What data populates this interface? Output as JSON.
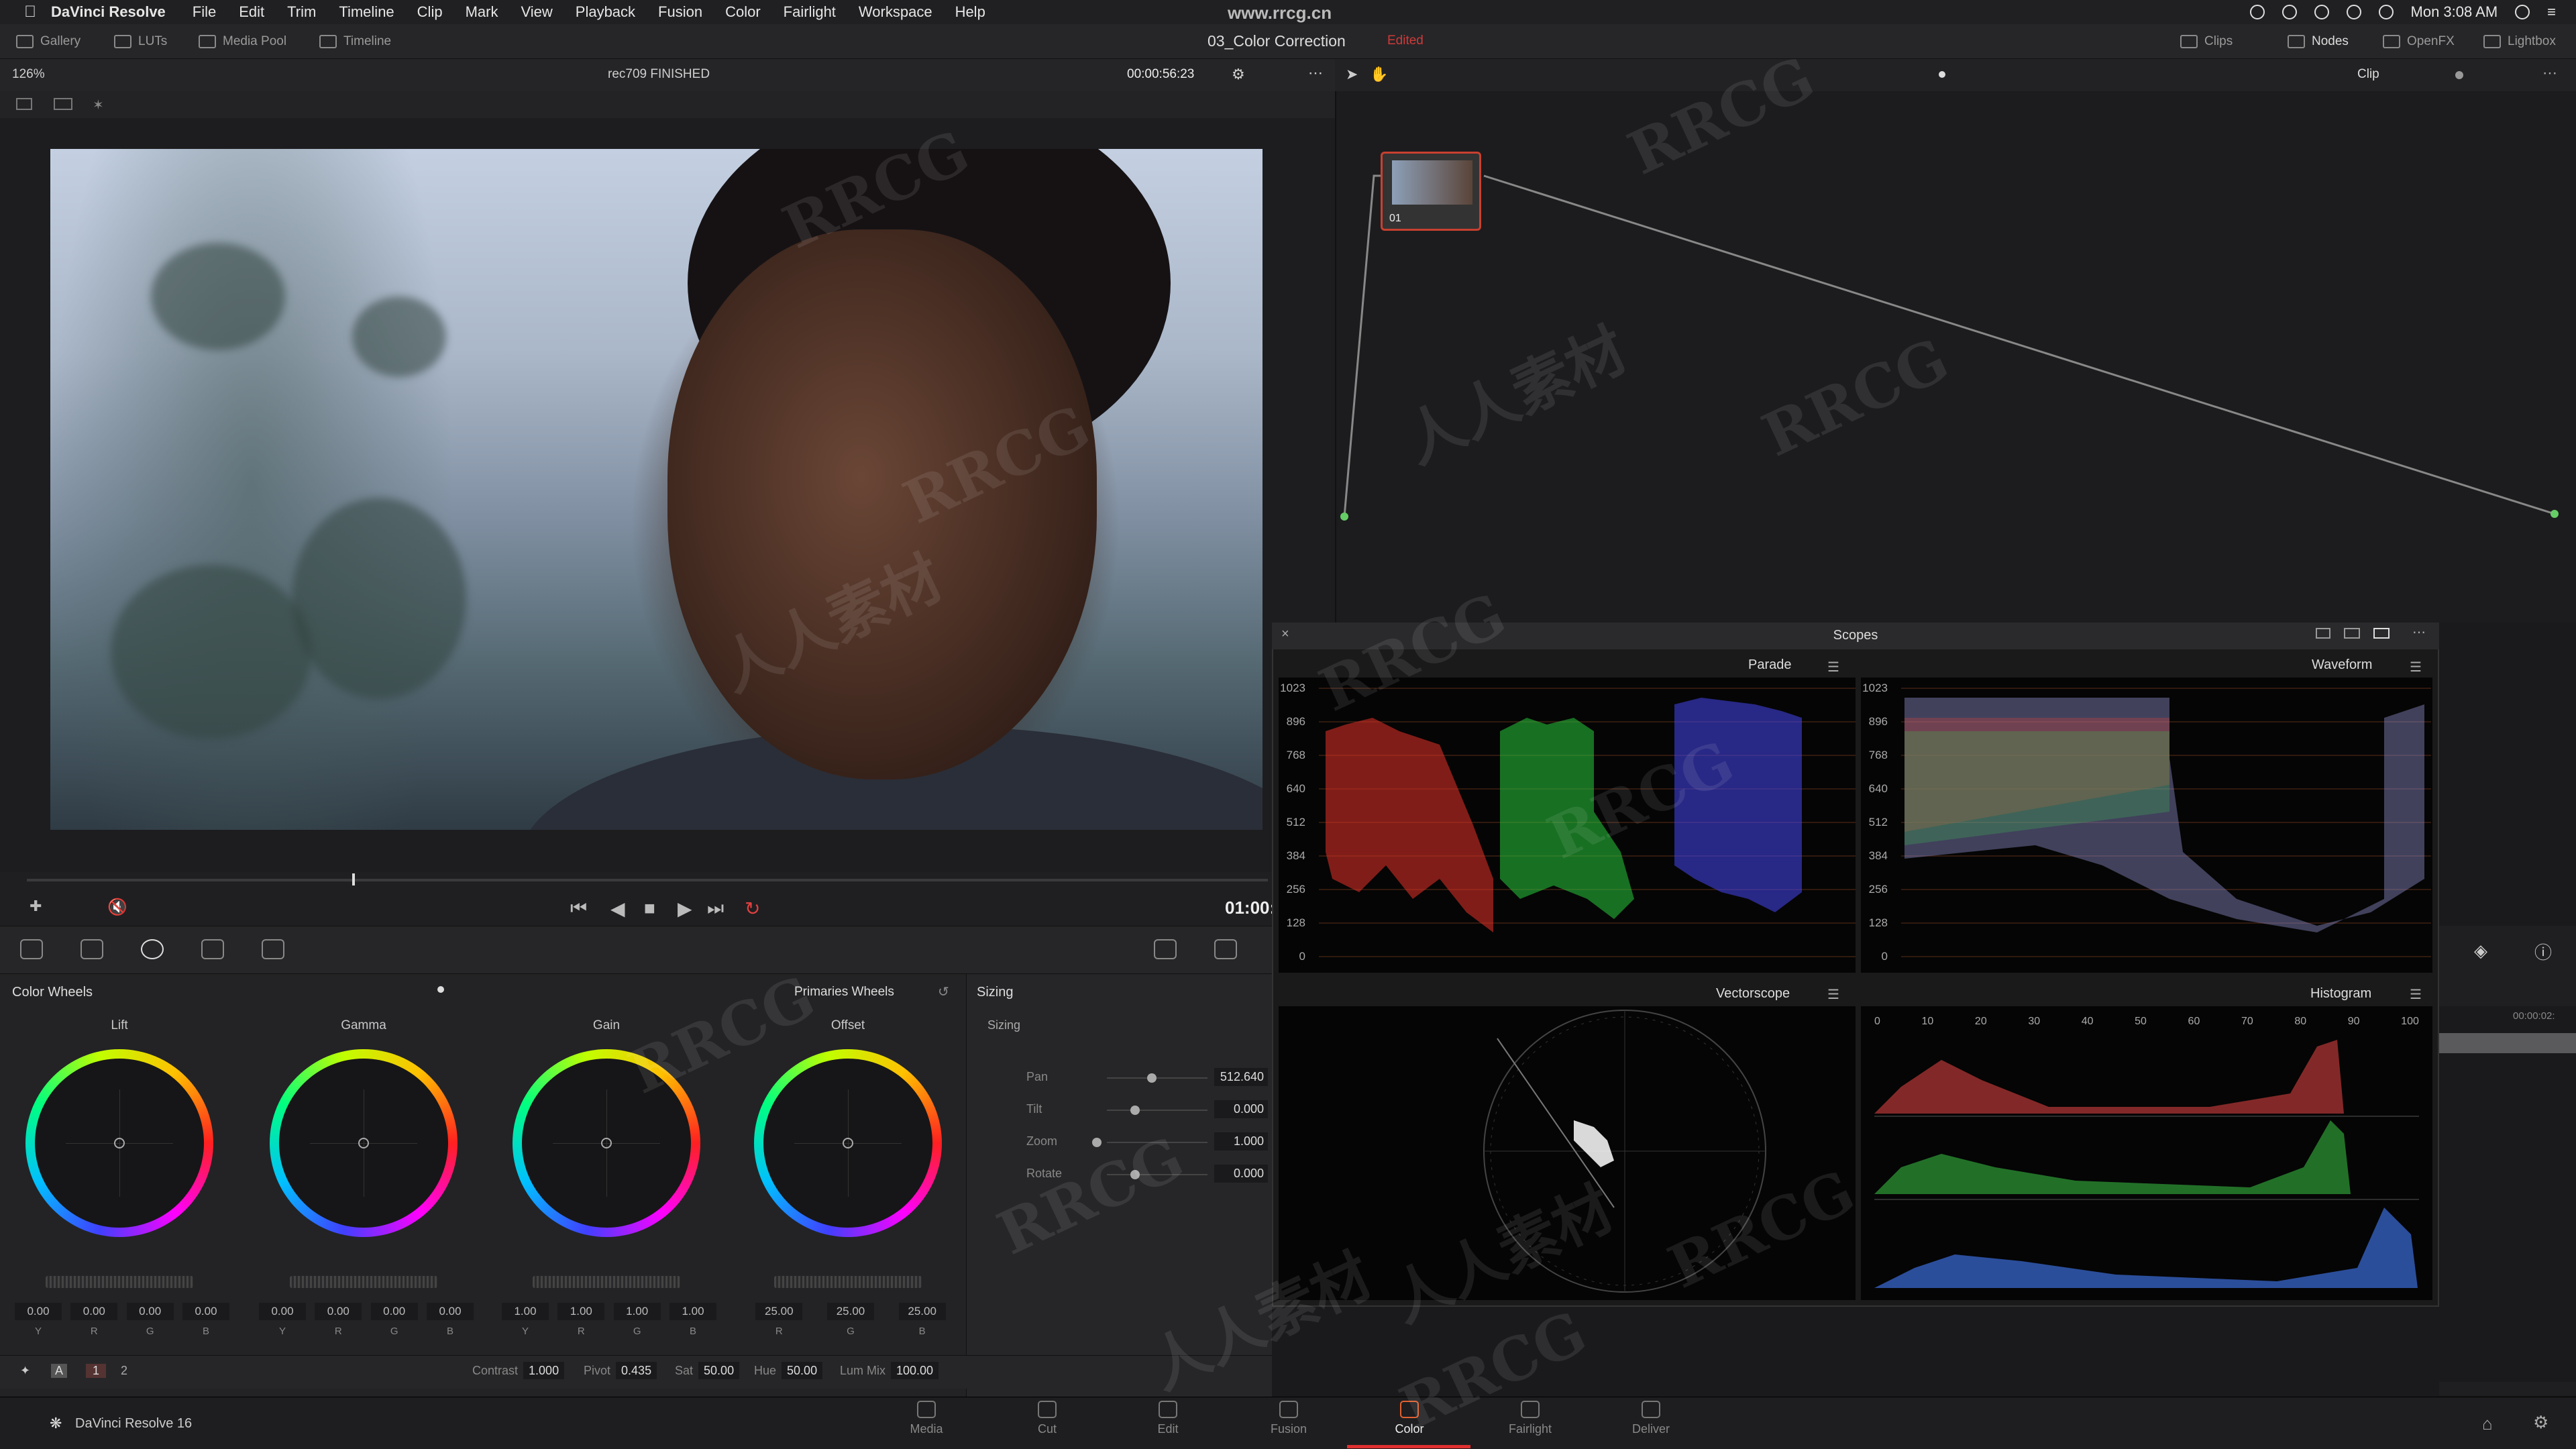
{
  "menubar": {
    "app": "DaVinci Resolve",
    "items": [
      "File",
      "Edit",
      "Trim",
      "Timeline",
      "Clip",
      "Mark",
      "View",
      "Playback",
      "Fusion",
      "Color",
      "Fairlight",
      "Workspace",
      "Help"
    ],
    "url": "www.rrcg.cn",
    "clock": "Mon 3:08 AM"
  },
  "toolbar": {
    "gallery": "Gallery",
    "luts": "LUTs",
    "media_pool": "Media Pool",
    "timeline": "Timeline",
    "project": "03_Color Correction",
    "edited": "Edited",
    "clips": "Clips",
    "nodes": "Nodes",
    "openfx": "OpenFX",
    "lightbox": "Lightbox"
  },
  "viewer": {
    "zoom": "126%",
    "timeline_name": "rec709 FINISHED",
    "timecode": "00:00:56:23",
    "timecode_bottom": "01:00:"
  },
  "nodes": {
    "mode": "Clip",
    "node_label": "01"
  },
  "color_wheels": {
    "title": "Color Wheels",
    "mode": "Primaries Wheels",
    "wheels": [
      {
        "label": "Lift",
        "values": [
          "0.00",
          "0.00",
          "0.00",
          "0.00"
        ]
      },
      {
        "label": "Gamma",
        "values": [
          "0.00",
          "0.00",
          "0.00",
          "0.00"
        ]
      },
      {
        "label": "Gain",
        "values": [
          "1.00",
          "1.00",
          "1.00",
          "1.00"
        ]
      },
      {
        "label": "Offset",
        "values": [
          "25.00",
          "25.00",
          "25.00"
        ]
      }
    ],
    "channel_labels": [
      "Y",
      "R",
      "G",
      "B"
    ]
  },
  "sizing": {
    "title": "Sizing",
    "sub": "Sizing",
    "rows": [
      {
        "label": "Pan",
        "value": "512.640"
      },
      {
        "label": "Tilt",
        "value": "0.000"
      },
      {
        "label": "Zoom",
        "value": "1.000"
      },
      {
        "label": "Rotate",
        "value": "0.000"
      }
    ]
  },
  "adjust": {
    "page_a": "1",
    "page_b": "2",
    "contrast_label": "Contrast",
    "contrast": "1.000",
    "pivot_label": "Pivot",
    "pivot": "0.435",
    "sat_label": "Sat",
    "sat": "50.00",
    "hue_label": "Hue",
    "hue": "50.00",
    "lummix_label": "Lum Mix",
    "lummix": "100.00"
  },
  "scopes": {
    "title": "Scopes",
    "parade": "Parade",
    "waveform": "Waveform",
    "vectorscope": "Vectorscope",
    "histogram": "Histogram",
    "scale": [
      "1023",
      "896",
      "768",
      "640",
      "512",
      "384",
      "256",
      "128",
      "0"
    ],
    "hist_ticks": [
      "0",
      "10",
      "20",
      "30",
      "40",
      "50",
      "60",
      "70",
      "80",
      "90",
      "100"
    ]
  },
  "right_panel": {
    "timecode": "00:00:02:"
  },
  "pagebar": {
    "product": "DaVinci Resolve 16",
    "pages": [
      "Media",
      "Cut",
      "Edit",
      "Fusion",
      "Color",
      "Fairlight",
      "Deliver"
    ],
    "active": "Color"
  },
  "watermarks": [
    "RRCG",
    "人人素材"
  ]
}
